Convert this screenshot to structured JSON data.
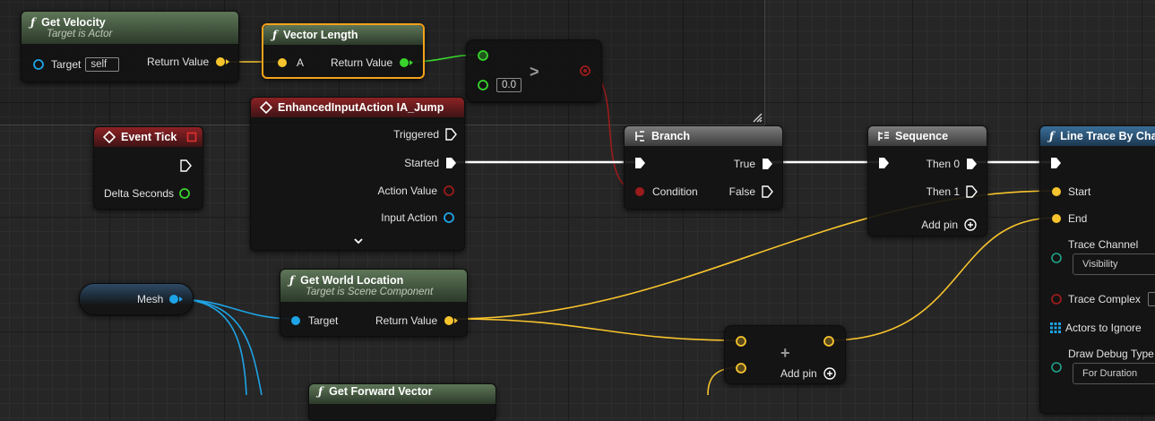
{
  "nodes": {
    "get_velocity": {
      "title": "Get Velocity",
      "subtitle": "Target is Actor",
      "target_label": "Target",
      "target_value": "self",
      "return_label": "Return Value"
    },
    "vector_length": {
      "title": "Vector Length",
      "a_label": "A",
      "return_label": "Return Value"
    },
    "greater": {
      "operator": ">",
      "b_value": "0.0"
    },
    "event_tick": {
      "title": "Event Tick",
      "delta_label": "Delta Seconds"
    },
    "input_action": {
      "title": "EnhancedInputAction IA_Jump",
      "triggered": "Triggered",
      "started": "Started",
      "action_value": "Action Value",
      "input_action": "Input Action",
      "expand": "⌄"
    },
    "branch": {
      "title": "Branch",
      "true_label": "True",
      "false_label": "False",
      "condition_label": "Condition"
    },
    "sequence": {
      "title": "Sequence",
      "then0": "Then 0",
      "then1": "Then 1",
      "add_pin": "Add pin"
    },
    "line_trace": {
      "title": "Line Trace By Cha",
      "start": "Start",
      "end": "End",
      "trace_channel": "Trace Channel",
      "trace_channel_value": "Visibility",
      "trace_complex": "Trace Complex",
      "actors_to_ignore": "Actors to Ignore",
      "draw_debug_type": "Draw Debug Type",
      "draw_debug_value": "For Duration"
    },
    "mesh": {
      "label": "Mesh"
    },
    "get_world_location": {
      "title": "Get World Location",
      "subtitle": "Target is Scene Component",
      "target_label": "Target",
      "return_label": "Return Value"
    },
    "add": {
      "operator": "+",
      "add_pin": "Add pin"
    },
    "get_forward_vector": {
      "title": "Get Forward Vector"
    }
  },
  "colors": {
    "exec": "#ffffff",
    "vector": "#f8c42d",
    "float": "#38d42c",
    "bool": "#9c1b1b",
    "object": "#1ea4e6",
    "selection": "#f4a21a"
  }
}
